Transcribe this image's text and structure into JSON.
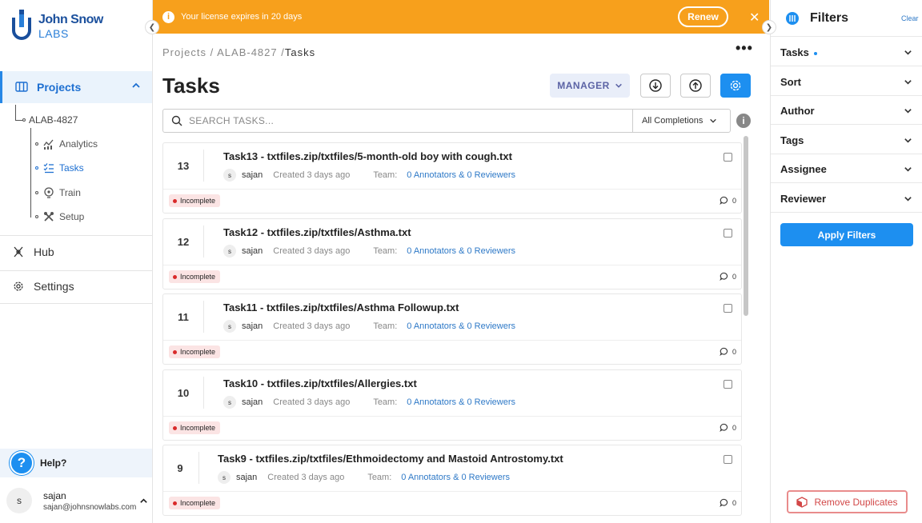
{
  "banner": {
    "message": "Your license expires in 20 days",
    "renew_label": "Renew"
  },
  "logo": {
    "line1": "John Snow",
    "line2": "LABS"
  },
  "sidebar": {
    "projects_label": "Projects",
    "project_name": "ALAB-4827",
    "sub_items": [
      {
        "label": "Analytics",
        "icon": "analytics-icon"
      },
      {
        "label": "Tasks",
        "icon": "tasks-icon"
      },
      {
        "label": "Train",
        "icon": "train-icon"
      },
      {
        "label": "Setup",
        "icon": "setup-icon"
      }
    ],
    "hub_label": "Hub",
    "settings_label": "Settings",
    "help_label": "Help?",
    "user": {
      "initial": "s",
      "name": "sajan",
      "email": "sajan@johnsnowlabs.com"
    }
  },
  "breadcrumb": {
    "part1": "Projects",
    "sep": "/",
    "part2": "ALAB-4827",
    "current": "Tasks"
  },
  "page": {
    "title": "Tasks",
    "manager_label": "MANAGER",
    "search_placeholder": "SEARCH TASKS...",
    "completions_label": "All Completions"
  },
  "tasks": [
    {
      "id": "13",
      "title": "Task13 - txtfiles.zip/txtfiles/5-month-old boy with cough.txt",
      "user_initial": "s",
      "user": "sajan",
      "created": "Created 3 days ago",
      "team_label": "Team:",
      "team": "0 Annotators & 0 Reviewers",
      "status": "Incomplete",
      "comments": "0"
    },
    {
      "id": "12",
      "title": "Task12 - txtfiles.zip/txtfiles/Asthma.txt",
      "user_initial": "s",
      "user": "sajan",
      "created": "Created 3 days ago",
      "team_label": "Team:",
      "team": "0 Annotators & 0 Reviewers",
      "status": "Incomplete",
      "comments": "0"
    },
    {
      "id": "11",
      "title": "Task11 - txtfiles.zip/txtfiles/Asthma Followup.txt",
      "user_initial": "s",
      "user": "sajan",
      "created": "Created 3 days ago",
      "team_label": "Team:",
      "team": "0 Annotators & 0 Reviewers",
      "status": "Incomplete",
      "comments": "0"
    },
    {
      "id": "10",
      "title": "Task10 - txtfiles.zip/txtfiles/Allergies.txt",
      "user_initial": "s",
      "user": "sajan",
      "created": "Created 3 days ago",
      "team_label": "Team:",
      "team": "0 Annotators & 0 Reviewers",
      "status": "Incomplete",
      "comments": "0"
    },
    {
      "id": "9",
      "title": "Task9 - txtfiles.zip/txtfiles/Ethmoidectomy and Mastoid Antrostomy.txt",
      "user_initial": "s",
      "user": "sajan",
      "created": "Created 3 days ago",
      "team_label": "Team:",
      "team": "0 Annotators & 0 Reviewers",
      "status": "Incomplete",
      "comments": "0"
    }
  ],
  "filters": {
    "title": "Filters",
    "clear_label": "Clear",
    "rows": [
      "Tasks",
      "Sort",
      "Author",
      "Tags",
      "Assignee",
      "Reviewer"
    ],
    "apply_label": "Apply Filters",
    "remove_duplicates_label": "Remove Duplicates"
  },
  "colors": {
    "accent": "#1d8ff0",
    "banner": "#f7a01c",
    "incomplete": "#d92a2a"
  }
}
